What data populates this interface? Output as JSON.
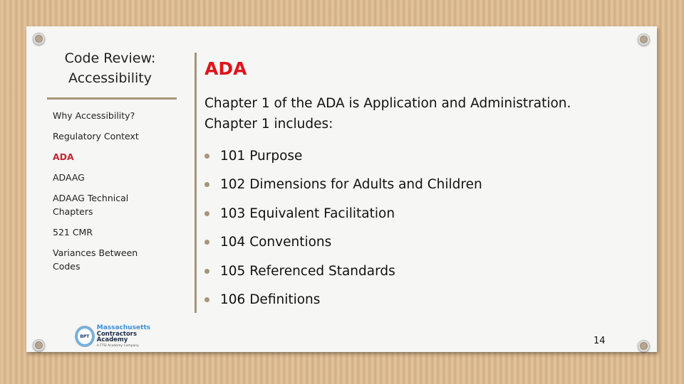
{
  "sidebar": {
    "title": "Code Review: Accessibility",
    "items": [
      {
        "label": "Why Accessibility?",
        "active": false
      },
      {
        "label": "Regulatory Context",
        "active": false
      },
      {
        "label": "ADA",
        "active": true
      },
      {
        "label": "ADAAG",
        "active": false
      },
      {
        "label": "ADAAG Technical Chapters",
        "active": false
      },
      {
        "label": "521 CMR",
        "active": false
      },
      {
        "label": "Variances Between Codes",
        "active": false
      }
    ],
    "logo": {
      "seal_text": "BPT",
      "line1": "Massachusetts",
      "line2": "Contractors Academy",
      "line3": "A FTSI Academy Company"
    }
  },
  "main": {
    "title": "ADA",
    "intro": "Chapter 1 of the ADA is Application and Administration. Chapter 1 includes:",
    "bullets": [
      "101 Purpose",
      "102 Dimensions for Adults and Children",
      "103 Equivalent Facilitation",
      "104 Conventions",
      "105 Referenced Standards",
      "106 Definitions"
    ]
  },
  "page_number": "14",
  "colors": {
    "accent_red": "#e0141b",
    "active_nav": "#c0282f",
    "rule": "#a89479",
    "background_cardboard": "#dcbb91",
    "paper": "#f6f6f4"
  }
}
